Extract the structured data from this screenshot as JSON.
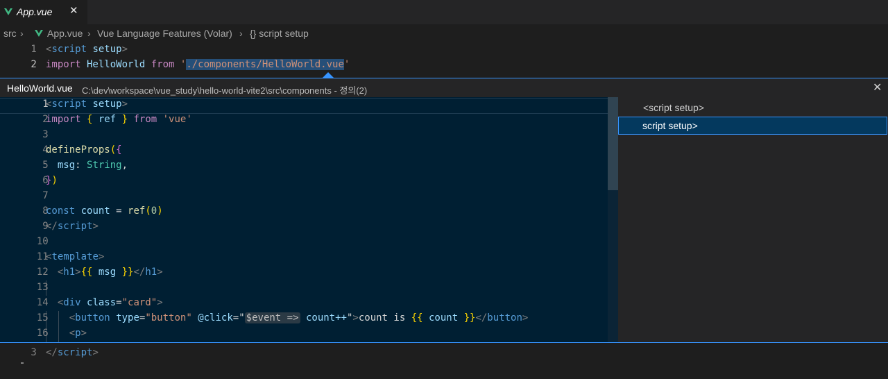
{
  "tab": {
    "title": "App.vue",
    "close": "✕"
  },
  "breadcrumb": {
    "items": [
      "src",
      "App.vue",
      "Vue Language Features (Volar)",
      "{} script setup"
    ],
    "sep": "›"
  },
  "main_editor": {
    "lines": [
      {
        "n": "1"
      },
      {
        "n": "2"
      }
    ],
    "line1": {
      "open": "<",
      "tag": "script",
      "sp": " ",
      "attr": "setup",
      "close": ">"
    },
    "line2": {
      "kw": "import",
      "name": " HelloWorld ",
      "from": "from",
      "q1": " '",
      "path": "./components/HelloWorld.vue",
      "q2": "'"
    },
    "bottom_line": {
      "n": "3",
      "open": "</",
      "tag": "script",
      "close": ">"
    }
  },
  "peek": {
    "file": "HelloWorld.vue",
    "path": "C:\\dev\\workspace\\vue_study\\hello-world-vite2\\src\\components - 정의(2)",
    "close": "✕",
    "tree": [
      "<script setup>",
      "script setup>"
    ],
    "line_numbers": [
      "1",
      "2",
      "3",
      "4",
      "5",
      "6",
      "7",
      "8",
      "9",
      "10",
      "11",
      "12",
      "13",
      "14",
      "15",
      "16"
    ],
    "code": {
      "l1": {
        "open": "<",
        "tag": "script",
        "sp": " ",
        "attr": "setup",
        "close": ">"
      },
      "l2": {
        "imp": "import",
        "b1": " { ",
        "ref": "ref",
        "b2": " } ",
        "from": "from",
        "str": " 'vue'"
      },
      "l4": {
        "fn": "defineProps",
        "p": "(",
        "b": "{"
      },
      "l5": {
        "key": "  msg",
        "colon": ": ",
        "type": "String",
        "comma": ","
      },
      "l6": {
        "b": "}",
        "p": ")"
      },
      "l8": {
        "kw": "const",
        "var": " count ",
        "eq": "= ",
        "fn": "ref",
        "p1": "(",
        "num": "0",
        "p2": ")"
      },
      "l9": {
        "open": "</",
        "tag": "script",
        "close": ">"
      },
      "l11": {
        "open": "<",
        "tag": "template",
        "close": ">"
      },
      "l12": {
        "open": "<",
        "tag": "h1",
        "close": ">",
        "m1": "{{",
        "var": " msg ",
        "m2": "}}",
        "eopen": "</",
        "etag": "h1",
        "eclose": ">"
      },
      "l14": {
        "open": "<",
        "tag": "div",
        "attr": " class",
        "eq": "=",
        "val": "\"card\"",
        "close": ">"
      },
      "l15": {
        "open": "<",
        "tag": "button",
        "attr": " type",
        "eq": "=",
        "val": "\"button\"",
        "click": " @click",
        "eq2": "=",
        "q": "\"",
        "ev": "$event",
        "arrow": " =>",
        "expr": " count++",
        "q2": "\"",
        "close": ">",
        "text": "count is ",
        "m1": "{{",
        "var": " count ",
        "m2": "}}",
        "eopen": "</",
        "etag": "button",
        "eclose": ">"
      },
      "l16": {
        "open": "<",
        "tag": "p",
        "close": ">"
      }
    }
  }
}
